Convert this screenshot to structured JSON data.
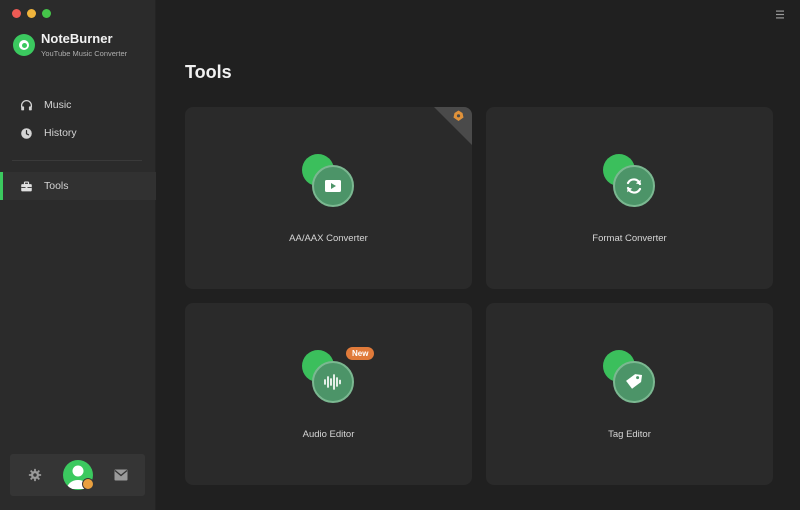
{
  "app": {
    "name": "NoteBurner",
    "subtitle": "YouTube Music Converter"
  },
  "sidebar": {
    "items": [
      {
        "id": "music",
        "label": "Music",
        "icon": "headphones-icon"
      },
      {
        "id": "history",
        "label": "History",
        "icon": "clock-icon"
      },
      {
        "id": "tools",
        "label": "Tools",
        "icon": "toolbox-icon",
        "active": true
      }
    ]
  },
  "main": {
    "title": "Tools",
    "cards": [
      {
        "label": "AA/AAX Converter",
        "icon": "video-icon",
        "corner_badge": "pro-icon"
      },
      {
        "label": "Format Converter",
        "icon": "refresh-icon"
      },
      {
        "label": "Audio Editor",
        "icon": "waveform-icon",
        "badge": "New"
      },
      {
        "label": "Tag Editor",
        "icon": "tag-icon"
      }
    ]
  },
  "colors": {
    "accent": "#3bc95f",
    "background": "#202020",
    "sidebar": "#2b2b2b",
    "card": "#2a2a2a",
    "badge": "#e07a3a"
  }
}
